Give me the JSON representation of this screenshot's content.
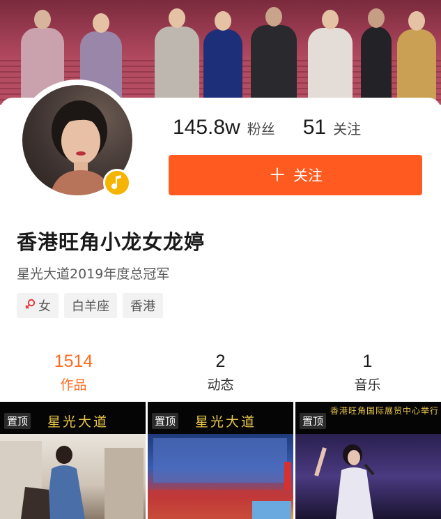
{
  "profile": {
    "followers_count": "145.8w",
    "followers_label": "粉丝",
    "following_count": "51",
    "following_label": "关注",
    "follow_button_label": "关注",
    "follow_button_icon": "plus-icon",
    "name": "香港旺角小龙女龙婷",
    "bio": "星光大道2019年度总冠军",
    "avatar_badge_icon": "music-note-icon",
    "tags": [
      {
        "icon": "female-icon",
        "label": "女"
      },
      {
        "label": "白羊座"
      },
      {
        "label": "香港"
      }
    ]
  },
  "tabs": [
    {
      "count": "1514",
      "label": "作品",
      "active": true
    },
    {
      "count": "2",
      "label": "动态",
      "active": false
    },
    {
      "count": "1",
      "label": "音乐",
      "active": false
    }
  ],
  "videos": [
    {
      "pin_label": "置顶",
      "title": "星光大道"
    },
    {
      "pin_label": "置顶",
      "title": "星光大道"
    },
    {
      "pin_label": "置顶",
      "title": "香港旺角国际展贸中心举行"
    }
  ],
  "colors": {
    "accent": "#ff5a1f",
    "active_tab": "#ff6a1f",
    "badge": "#f4b400",
    "video_title": "#e8c64a"
  }
}
